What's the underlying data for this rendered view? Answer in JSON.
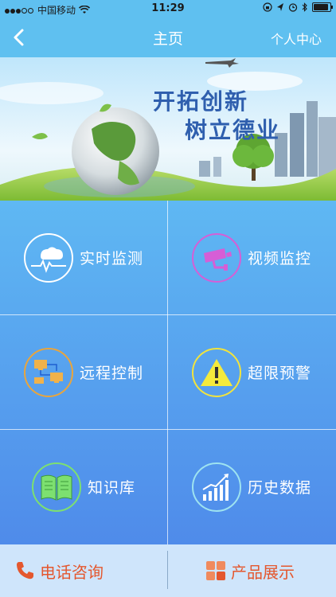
{
  "status_bar": {
    "carrier": "中国移动",
    "time": "11:29"
  },
  "nav": {
    "title": "主页",
    "right_label": "个人中心"
  },
  "banner": {
    "line1": "开拓创新",
    "line2": "树立德业"
  },
  "menu": [
    {
      "label": "实时监测",
      "icon": "cloud-heartbeat-icon"
    },
    {
      "label": "视频监控",
      "icon": "camera-icon"
    },
    {
      "label": "远程控制",
      "icon": "network-computers-icon"
    },
    {
      "label": "超限预警",
      "icon": "warning-icon"
    },
    {
      "label": "知识库",
      "icon": "book-icon"
    },
    {
      "label": "历史数据",
      "icon": "chart-icon"
    }
  ],
  "bottom": {
    "phone_label": "电话咨询",
    "products_label": "产品展示"
  },
  "colors": {
    "nav_bg": "#5fc0f0",
    "grid_top": "#5fb8f3",
    "grid_bottom": "#4f8bea",
    "bottom_bg": "#cfe5fb",
    "bottom_text": "#e4572e"
  }
}
